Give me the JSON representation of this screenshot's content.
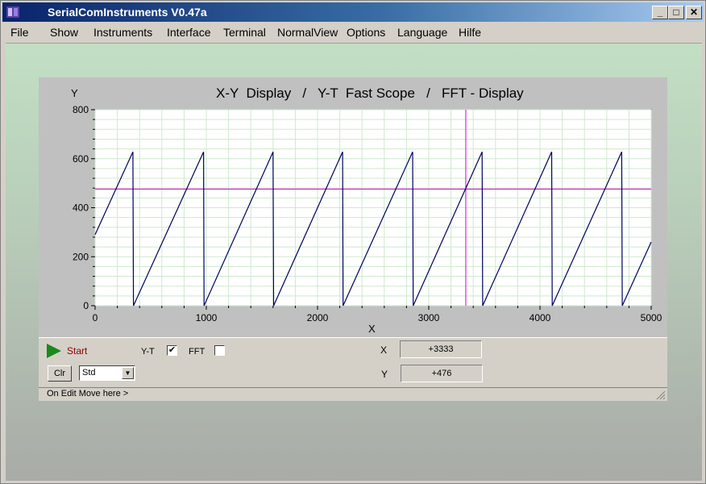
{
  "window": {
    "title": "SerialComInstruments  V0.47a",
    "controls": {
      "minimize": "_",
      "maximize": "□",
      "close": "✕"
    }
  },
  "menu": [
    "File",
    "Show",
    "Instruments",
    "Interface",
    "Terminal",
    "NormalView",
    "Options",
    "Language",
    "Hilfe"
  ],
  "plot": {
    "title": "X-Y  Display   /   Y-T  Fast Scope   /   FFT - Display",
    "ylabel": "Y",
    "xlabel": "X"
  },
  "chart_data": {
    "type": "line",
    "title": "X-Y  Display   /   Y-T  Fast Scope   /   FFT - Display",
    "xlabel": "X",
    "ylabel": "Y",
    "xlim": [
      0,
      5000
    ],
    "ylim": [
      0,
      800
    ],
    "x_ticks": [
      "0",
      "1000",
      "2000",
      "3000",
      "4000",
      "5000"
    ],
    "y_ticks": [
      "0",
      "200",
      "400",
      "600",
      "800"
    ],
    "grid": true,
    "line_color": "#000060",
    "cursor_color": "#cc00cc",
    "cursor": {
      "x": 3333,
      "y": 476
    },
    "series": [
      {
        "x": [
          0,
          340,
          345,
          975,
          980,
          1600,
          1605,
          2225,
          2230,
          2855,
          2860,
          3480,
          3485,
          4105,
          4110,
          4735,
          4740,
          5000
        ],
        "y": [
          290,
          628,
          0,
          628,
          0,
          628,
          0,
          628,
          0,
          628,
          0,
          628,
          0,
          628,
          0,
          628,
          0,
          260
        ]
      }
    ]
  },
  "controls": {
    "start_label": "Start",
    "yt_label": "Y-T",
    "yt_checked": "✔",
    "fft_label": "FFT",
    "fft_checked": "",
    "clr_label": "Clr",
    "std_value": "Std",
    "x_label": "X",
    "x_value": "+3333",
    "y_label": "Y",
    "y_value": "+476",
    "status_text": "On Edit Move here >"
  }
}
